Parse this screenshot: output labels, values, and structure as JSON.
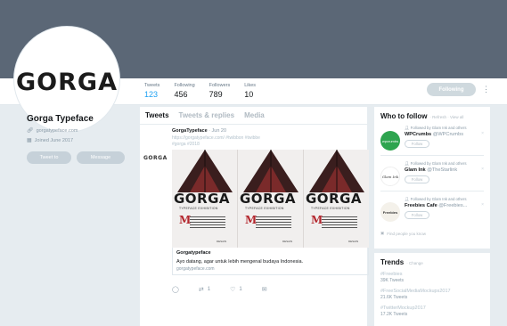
{
  "header": {
    "stats": [
      {
        "label": "Tweets",
        "value": "123"
      },
      {
        "label": "Following",
        "value": "456"
      },
      {
        "label": "Followers",
        "value": "789"
      },
      {
        "label": "Likes",
        "value": "10"
      }
    ],
    "follow_label": "Following",
    "more_label": "⋮"
  },
  "profile": {
    "avatar_logo": "GORGA",
    "name": "Gorga Typeface",
    "website": "gorgatypeface.com",
    "joined": "Joined June 2017",
    "tweet_to_label": "Tweet to",
    "message_label": "Message"
  },
  "timeline": {
    "tabs": [
      "Tweets",
      "Tweets & replies",
      "Media"
    ],
    "tweet": {
      "avatar_logo": "GORGA",
      "author": "GorgaTypeface",
      "date": " · Jun 20",
      "link": "https://gorgatypeface.com/ #twibbon #twibbe",
      "hashtag": "#gorga #2018",
      "poster_word": "GORGA",
      "poster_sub": "TYPEFACE EXHIBITION",
      "poster_m": "M",
      "poster_foot": "DESAIN",
      "card_title": "Gorgatypeface",
      "card_desc": "Ayo datang, agar untuk lebih mengenal budaya Indonesia.",
      "card_url": "gorgatypeface.com",
      "retweets": "1",
      "likes": "1"
    }
  },
  "who_to_follow": {
    "title": "Who to follow",
    "meta": "· Refresh · View all",
    "suggestions": [
      {
        "followed": "Followed by Glam Ink and others",
        "name": "WPCrumbs",
        "handle": "@WPCrumbs",
        "button": "Follow",
        "avatar_color": "#2ea44f",
        "avatar_text": "wpcrumbs"
      },
      {
        "followed": "Followed by Glam Ink and others",
        "name": "Glam Ink",
        "handle": "@TheStarlink",
        "button": "Follow",
        "avatar_color": "#ffffff",
        "avatar_text": "Glam Ink"
      },
      {
        "followed": "Followed by Glam Ink and others",
        "name": "Freebies Cafe",
        "handle": "@Freebies...",
        "button": "Follow",
        "avatar_color": "#f4f1ea",
        "avatar_text": "Freebies"
      }
    ],
    "find_people": "Find people you know"
  },
  "trends": {
    "title": "Trends",
    "meta": "· Change",
    "items": [
      {
        "name": "#Freebies",
        "count": "39K Tweets"
      },
      {
        "name": "#FreeSocialMediaMockups2017",
        "count": "21.6K Tweets"
      },
      {
        "name": "#TwitterMockup2017",
        "count": "17.2K Tweets"
      }
    ]
  },
  "colors": {
    "banner": "#5b6776",
    "accent": "#1da1f2",
    "poster_red": "#b3262d"
  }
}
